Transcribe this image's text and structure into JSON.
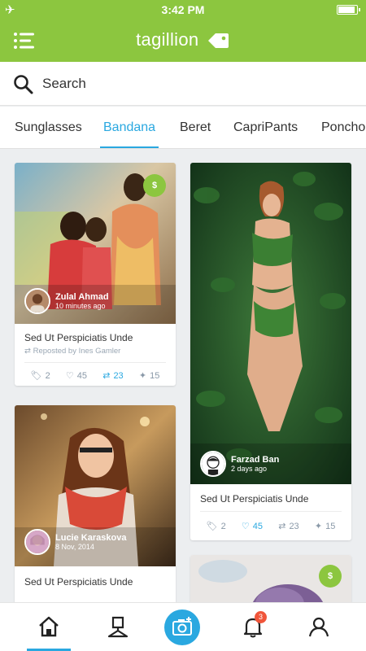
{
  "status": {
    "time": "3:42 PM"
  },
  "app": {
    "title": "tagillion"
  },
  "search": {
    "placeholder": "Search"
  },
  "tabs": [
    "Sunglasses",
    "Bandana",
    "Beret",
    "CapriPants",
    "Poncho"
  ],
  "active_tab": "Bandana",
  "cards": [
    {
      "user": "Zulal Ahmad",
      "time": "10 minutes ago",
      "title": "Sed Ut Perspiciatis Unde",
      "repost": "Reposted by Ines Gamler",
      "price_tag": "$",
      "stats": {
        "tags": "2",
        "likes": "45",
        "reposts": "23",
        "pins": "15"
      }
    },
    {
      "user": "Farzad Ban",
      "time": "2 days ago",
      "title": "Sed Ut Perspiciatis Unde",
      "stats": {
        "tags": "2",
        "likes": "45",
        "reposts": "23",
        "pins": "15"
      }
    },
    {
      "user": "Lucie Karaskova",
      "time": "8 Nov, 2014",
      "title": "Sed Ut Perspiciatis Unde"
    },
    {
      "price_tag": "$"
    }
  ],
  "notifications": {
    "count": "3"
  },
  "colors": {
    "brand_green": "#8cc63f",
    "accent_blue": "#2aa8e0",
    "badge_red": "#f0553a"
  },
  "icons": [
    "airplane-icon",
    "battery-icon",
    "menu-icon",
    "tag-logo-icon",
    "search-icon",
    "home-icon",
    "hanger-icon",
    "camera-icon",
    "bell-icon",
    "profile-icon"
  ]
}
